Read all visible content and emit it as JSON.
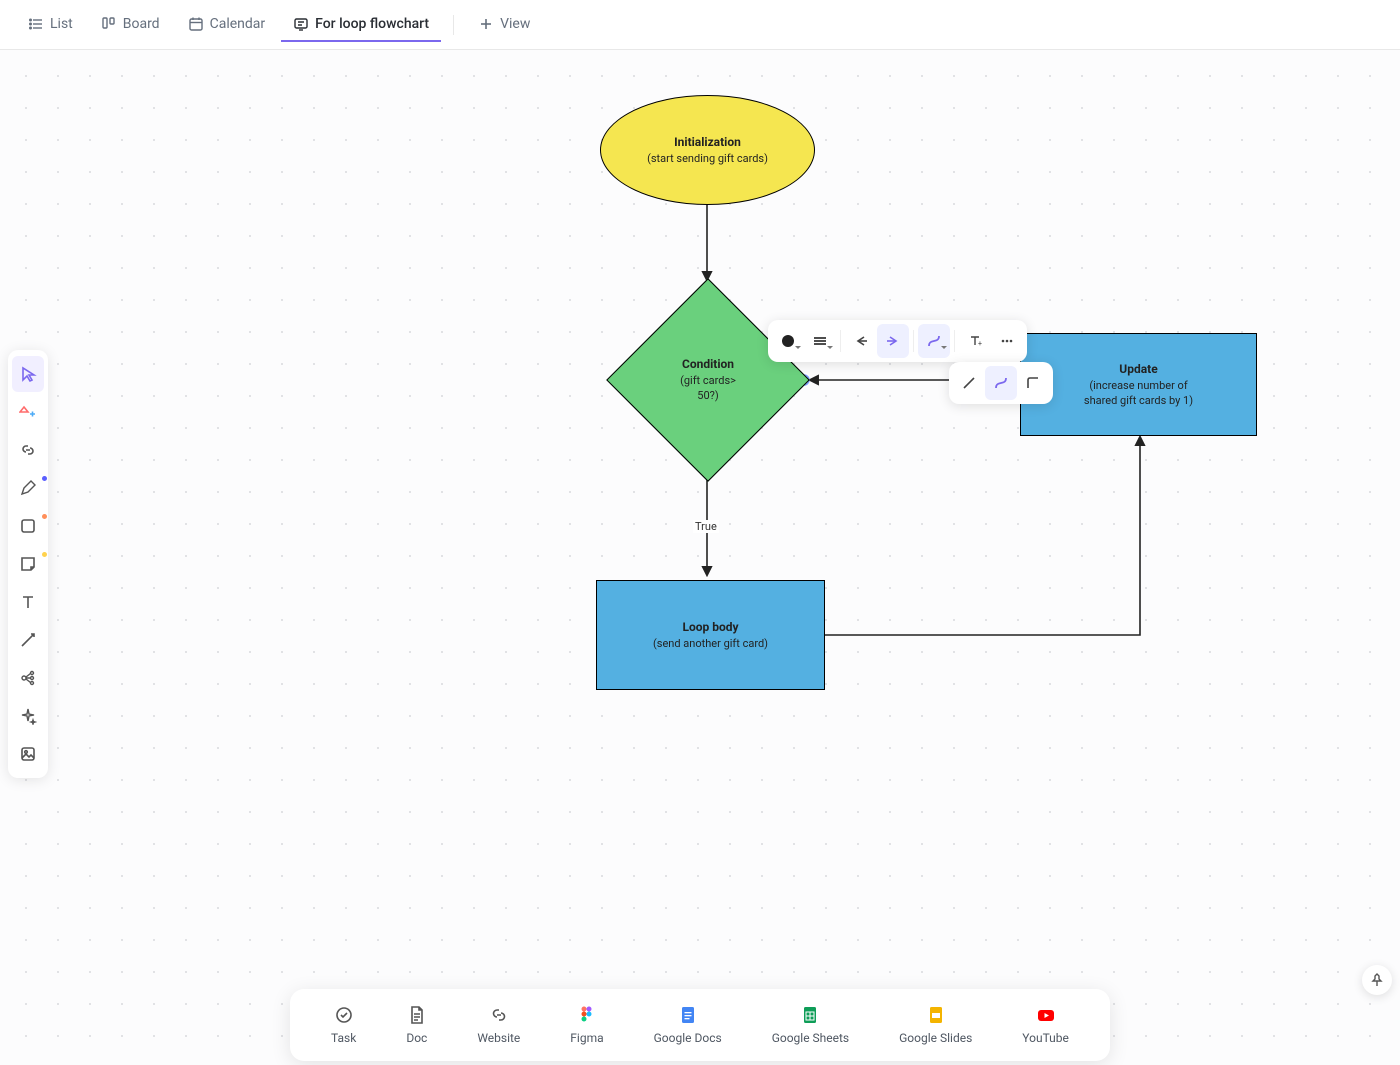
{
  "tabs": {
    "list": "List",
    "board": "Board",
    "calendar": "Calendar",
    "flowchart": "For loop flowchart",
    "add_view": "View"
  },
  "nodes": {
    "init": {
      "title": "Initialization",
      "sub": "(start sending gift cards)"
    },
    "cond": {
      "title": "Condition",
      "sub1": "(gift cards>",
      "sub2": "50?)"
    },
    "update": {
      "title": "Update",
      "sub1": "(increase number of",
      "sub2": "shared gift cards by 1)"
    },
    "body": {
      "title": "Loop body",
      "sub": "(send another gift card)"
    }
  },
  "edges": {
    "true_label": "True"
  },
  "dock": {
    "task": "Task",
    "doc": "Doc",
    "website": "Website",
    "figma": "Figma",
    "gdocs": "Google Docs",
    "gsheets": "Google Sheets",
    "gslides": "Google Slides",
    "youtube": "YouTube"
  },
  "colors": {
    "accent": "#7b68ee",
    "ellipse": "#f5e650",
    "diamond": "#6ad07d",
    "rect": "#54b0e1"
  }
}
